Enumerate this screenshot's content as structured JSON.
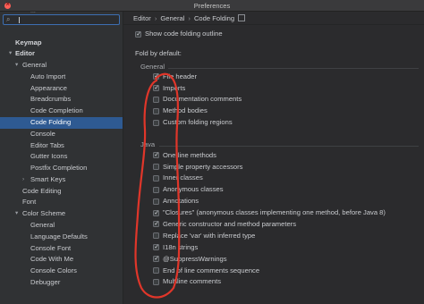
{
  "window": {
    "title": "Preferences"
  },
  "sidebar": {
    "search_placeholder": "",
    "partial_item": "...",
    "items": [
      {
        "label": "Keymap",
        "level": 0,
        "bold": true
      },
      {
        "label": "Editor",
        "level": 0,
        "bold": true,
        "expanded": true
      },
      {
        "label": "General",
        "level": 1,
        "expanded": true
      },
      {
        "label": "Auto Import",
        "level": 2
      },
      {
        "label": "Appearance",
        "level": 2
      },
      {
        "label": "Breadcrumbs",
        "level": 2
      },
      {
        "label": "Code Completion",
        "level": 2
      },
      {
        "label": "Code Folding",
        "level": 2,
        "selected": true
      },
      {
        "label": "Console",
        "level": 2
      },
      {
        "label": "Editor Tabs",
        "level": 2
      },
      {
        "label": "Gutter Icons",
        "level": 2
      },
      {
        "label": "Postfix Completion",
        "level": 2
      },
      {
        "label": "Smart Keys",
        "level": 2,
        "collapsed": true
      },
      {
        "label": "Code Editing",
        "level": 1
      },
      {
        "label": "Font",
        "level": 1
      },
      {
        "label": "Color Scheme",
        "level": 1,
        "expanded": true
      },
      {
        "label": "General",
        "level": 2
      },
      {
        "label": "Language Defaults",
        "level": 2
      },
      {
        "label": "Console Font",
        "level": 2
      },
      {
        "label": "Code With Me",
        "level": 2
      },
      {
        "label": "Console Colors",
        "level": 2
      },
      {
        "label": "Debugger",
        "level": 2
      }
    ]
  },
  "breadcrumb": [
    "Editor",
    "General",
    "Code Folding"
  ],
  "breadcrumb_sep": "›",
  "show_outline": {
    "label": "Show code folding outline",
    "checked": true
  },
  "fold_by_default_label": "Fold by default:",
  "groups": [
    {
      "name": "General",
      "options": [
        {
          "label": "File header",
          "checked": true
        },
        {
          "label": "Imports",
          "checked": true
        },
        {
          "label": "Documentation comments",
          "checked": false
        },
        {
          "label": "Method bodies",
          "checked": false
        },
        {
          "label": "Custom folding regions",
          "checked": false
        }
      ]
    },
    {
      "name": "Java",
      "options": [
        {
          "label": "One-line methods",
          "checked": true
        },
        {
          "label": "Simple property accessors",
          "checked": false
        },
        {
          "label": "Inner classes",
          "checked": false
        },
        {
          "label": "Anonymous classes",
          "checked": false
        },
        {
          "label": "Annotations",
          "checked": false
        },
        {
          "label": "\"Closures\" (anonymous classes implementing one method, before Java 8)",
          "checked": true
        },
        {
          "label": "Generic constructor and method parameters",
          "checked": true
        },
        {
          "label": "Replace 'var' with inferred type",
          "checked": false
        },
        {
          "label": "I18n strings",
          "checked": true
        },
        {
          "label": "@SuppressWarnings",
          "checked": true
        },
        {
          "label": "End of line comments sequence",
          "checked": false
        },
        {
          "label": "Multiline comments",
          "checked": false
        }
      ]
    }
  ],
  "colors": {
    "selection": "#2e5a92",
    "annotation_red": "#e0362a",
    "close_button": "#ff5f57"
  }
}
